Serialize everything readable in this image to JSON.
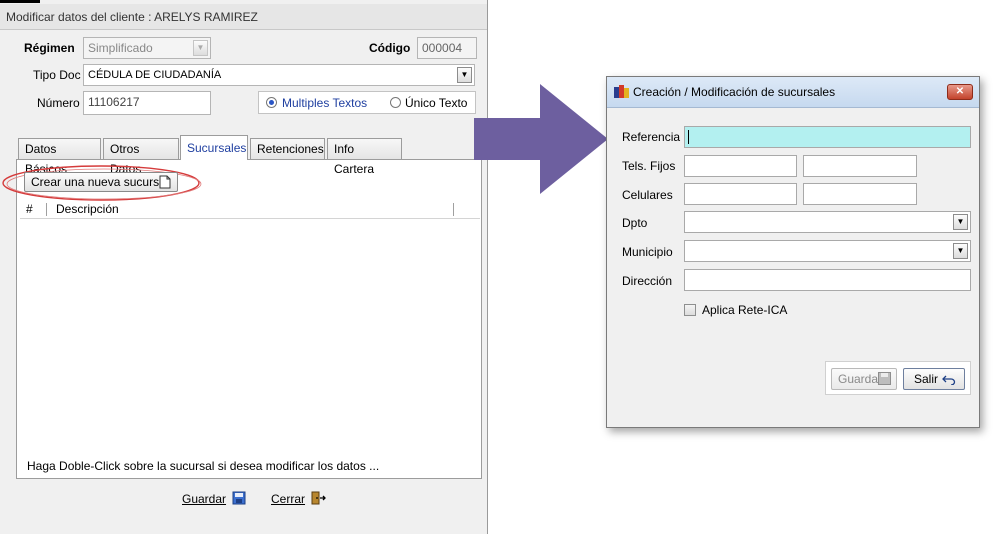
{
  "left_window": {
    "title": "Modificar datos del cliente : ARELYS RAMIREZ",
    "regimen": {
      "label": "Régimen",
      "value": "Simplificado"
    },
    "codigo": {
      "label": "Código",
      "value": "000004"
    },
    "tipo_doc": {
      "label": "Tipo Doc",
      "value": "CÉDULA DE CIUDADANÍA"
    },
    "numero": {
      "label": "Número",
      "value": "11106217"
    },
    "radio_multiples": "Multiples Textos",
    "radio_unico": "Único Texto",
    "tabs": [
      "Datos Básicos",
      "Otros Datos",
      "Sucursales",
      "Retenciones",
      "Info Cartera"
    ],
    "new_branch_button": "Crear una nueva sucursal",
    "grid_columns": [
      "#",
      "Descripción"
    ],
    "hint": "Haga Doble-Click sobre la sucursal si desea modificar los datos ...",
    "save_label": "Guardar",
    "close_label": "Cerrar"
  },
  "right_window": {
    "title": "Creación / Modificación de sucursales",
    "labels": {
      "referencia": "Referencia",
      "tels_fijos": "Tels. Fijos",
      "celulares": "Celulares",
      "dpto": "Dpto",
      "municipio": "Municipio",
      "direccion": "Dirección"
    },
    "checkbox_label": "Aplica Rete-ICA",
    "save_label": "Guardar",
    "exit_label": "Salir"
  },
  "colors": {
    "arrow": "#6d5f9f",
    "referencia_bg": "#b3f0f0",
    "highlight_ellipse": "#d53b3b",
    "active_tab_text": "#1f3fa0"
  }
}
